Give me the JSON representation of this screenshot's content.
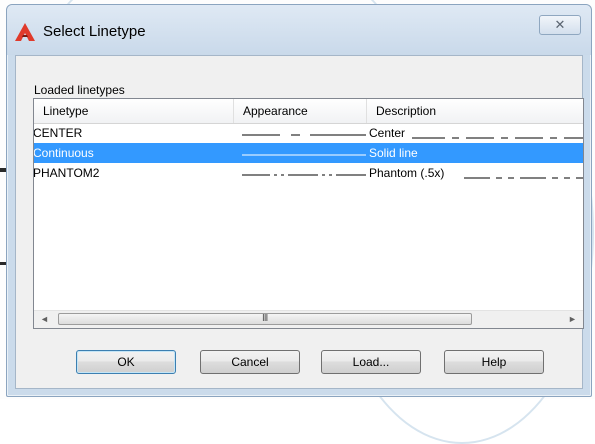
{
  "window": {
    "title": "Select Linetype",
    "close_glyph": "✕"
  },
  "group": {
    "label": "Loaded linetypes"
  },
  "table": {
    "columns": [
      "Linetype",
      "Appearance",
      "Description"
    ],
    "rows": [
      {
        "linetype": "CENTER",
        "description": "Center",
        "pattern": "center",
        "selected": false
      },
      {
        "linetype": "Continuous",
        "description": "Solid line",
        "pattern": "continuous",
        "selected": true
      },
      {
        "linetype": "PHANTOM2",
        "description": "Phantom (.5x)",
        "pattern": "phantom",
        "selected": false
      }
    ]
  },
  "scrollbar": {
    "left_arrow": "◄",
    "right_arrow": "►",
    "grip": "III"
  },
  "buttons": {
    "ok": "OK",
    "cancel": "Cancel",
    "load": "Load...",
    "help": "Help"
  },
  "colors": {
    "selection": "#3399ff",
    "title_bar": "#cbdbeb",
    "app_icon": "#e03a2b"
  }
}
